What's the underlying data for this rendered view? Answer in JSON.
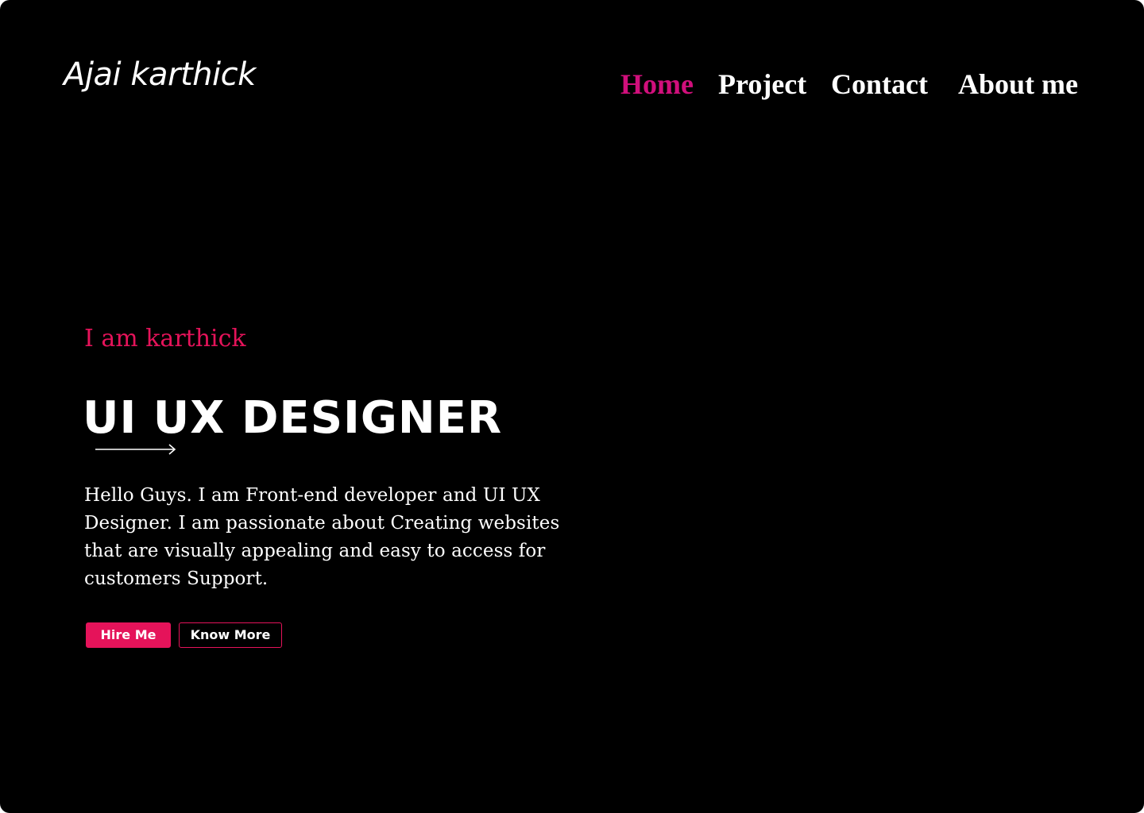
{
  "header": {
    "logo_text": "Ajai karthick",
    "nav": [
      {
        "label": "Home",
        "active": true
      },
      {
        "label": "Project",
        "active": false
      },
      {
        "label": "Contact",
        "active": false
      },
      {
        "label": "About me",
        "active": false
      }
    ]
  },
  "hero": {
    "greeting": "I am karthick",
    "headline": "UI UX DESIGNER",
    "description": "Hello Guys. I am Front-end  developer and UI UX Designer. I am passionate about Creating websites that are visually appealing and easy to access  for customers Support.",
    "buttons": {
      "primary_label": "Hire Me",
      "secondary_label": "Know More"
    },
    "decoration_icon": "arrow-right-icon"
  },
  "colors": {
    "background": "#000000",
    "text": "#ffffff",
    "accent": "#e5135a",
    "nav_active": "#d10f7c"
  }
}
